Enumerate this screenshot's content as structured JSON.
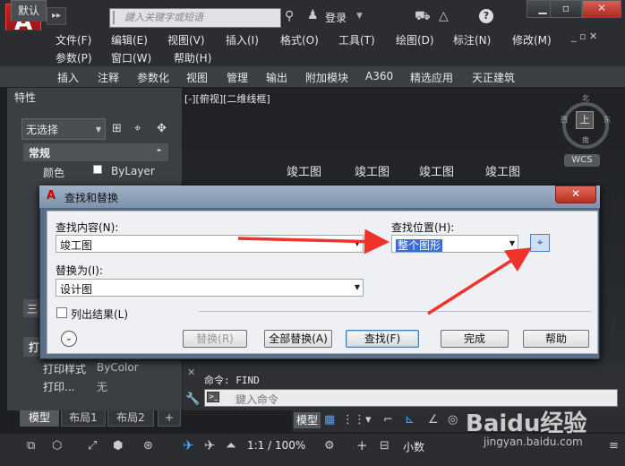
{
  "app": {
    "logo_letter": "A"
  },
  "titlebar": {
    "qa_arrow": "▸▸",
    "search_placeholder": "鍵入关键字或短语",
    "login": "登录",
    "help": "?",
    "win_min": "▁",
    "win_restore": "▫",
    "win_close": "✕"
  },
  "menubar": {
    "row1": [
      "文件(F)",
      "编辑(E)",
      "视图(V)",
      "插入(I)",
      "格式(O)",
      "工具(T)",
      "绘图(D)",
      "标注(N)",
      "修改(M)"
    ],
    "row2": [
      "参数(P)",
      "窗口(W)",
      "帮助(H)"
    ]
  },
  "ribbon": {
    "tabs": [
      "默认",
      "插入",
      "注释",
      "参数化",
      "视图",
      "管理",
      "输出",
      "附加模块",
      "A360",
      "精选应用",
      "天正建筑"
    ]
  },
  "palette": {
    "title": "特性",
    "selection": "无选择",
    "section_general": "常规",
    "section_general_toggle": "-",
    "color_label": "颜色",
    "color_value": "ByLayer",
    "section_print": "打",
    "side_3": "三",
    "print_style_label": "打印样式",
    "print_style_value": "ByColor",
    "print_label": "打印...",
    "print_value": "无"
  },
  "drawing": {
    "view_label": "[-][俯视][二维线框]",
    "texts": [
      "竣工图",
      "竣工图",
      "竣工图",
      "竣工图"
    ],
    "compass": {
      "n": "北",
      "s": "南",
      "w": "西",
      "e": "东",
      "center": "上"
    },
    "wcs": "WCS"
  },
  "dialog": {
    "title": "查找和替换",
    "close": "✕",
    "find_label": "查找内容(N):",
    "find_value": "竣工图",
    "where_label": "查找位置(H):",
    "where_value": "整个图形",
    "replace_label": "替换为(I):",
    "replace_value": "设计图",
    "list_results": "列出结果(L)",
    "expand": "⌄",
    "buttons": {
      "replace": "替换(R)",
      "replace_all": "全部替换(A)",
      "find": "查找(F)",
      "done": "完成",
      "help": "帮助"
    }
  },
  "command": {
    "previous": "命令: FIND",
    "placeholder": "鍵入命令"
  },
  "layout_tabs": [
    "模型",
    "布局1",
    "布局2",
    "+"
  ],
  "status": {
    "model": "模型",
    "scale": "1:1 / 100%",
    "units": "小数"
  },
  "watermark": {
    "brand": "Baidu经验",
    "url": "jingyan.baidu.com"
  },
  "colors": {
    "accent_blue": "#3a6bd6",
    "arrow_red": "#f0322c",
    "autocad_red": "#c62128"
  }
}
